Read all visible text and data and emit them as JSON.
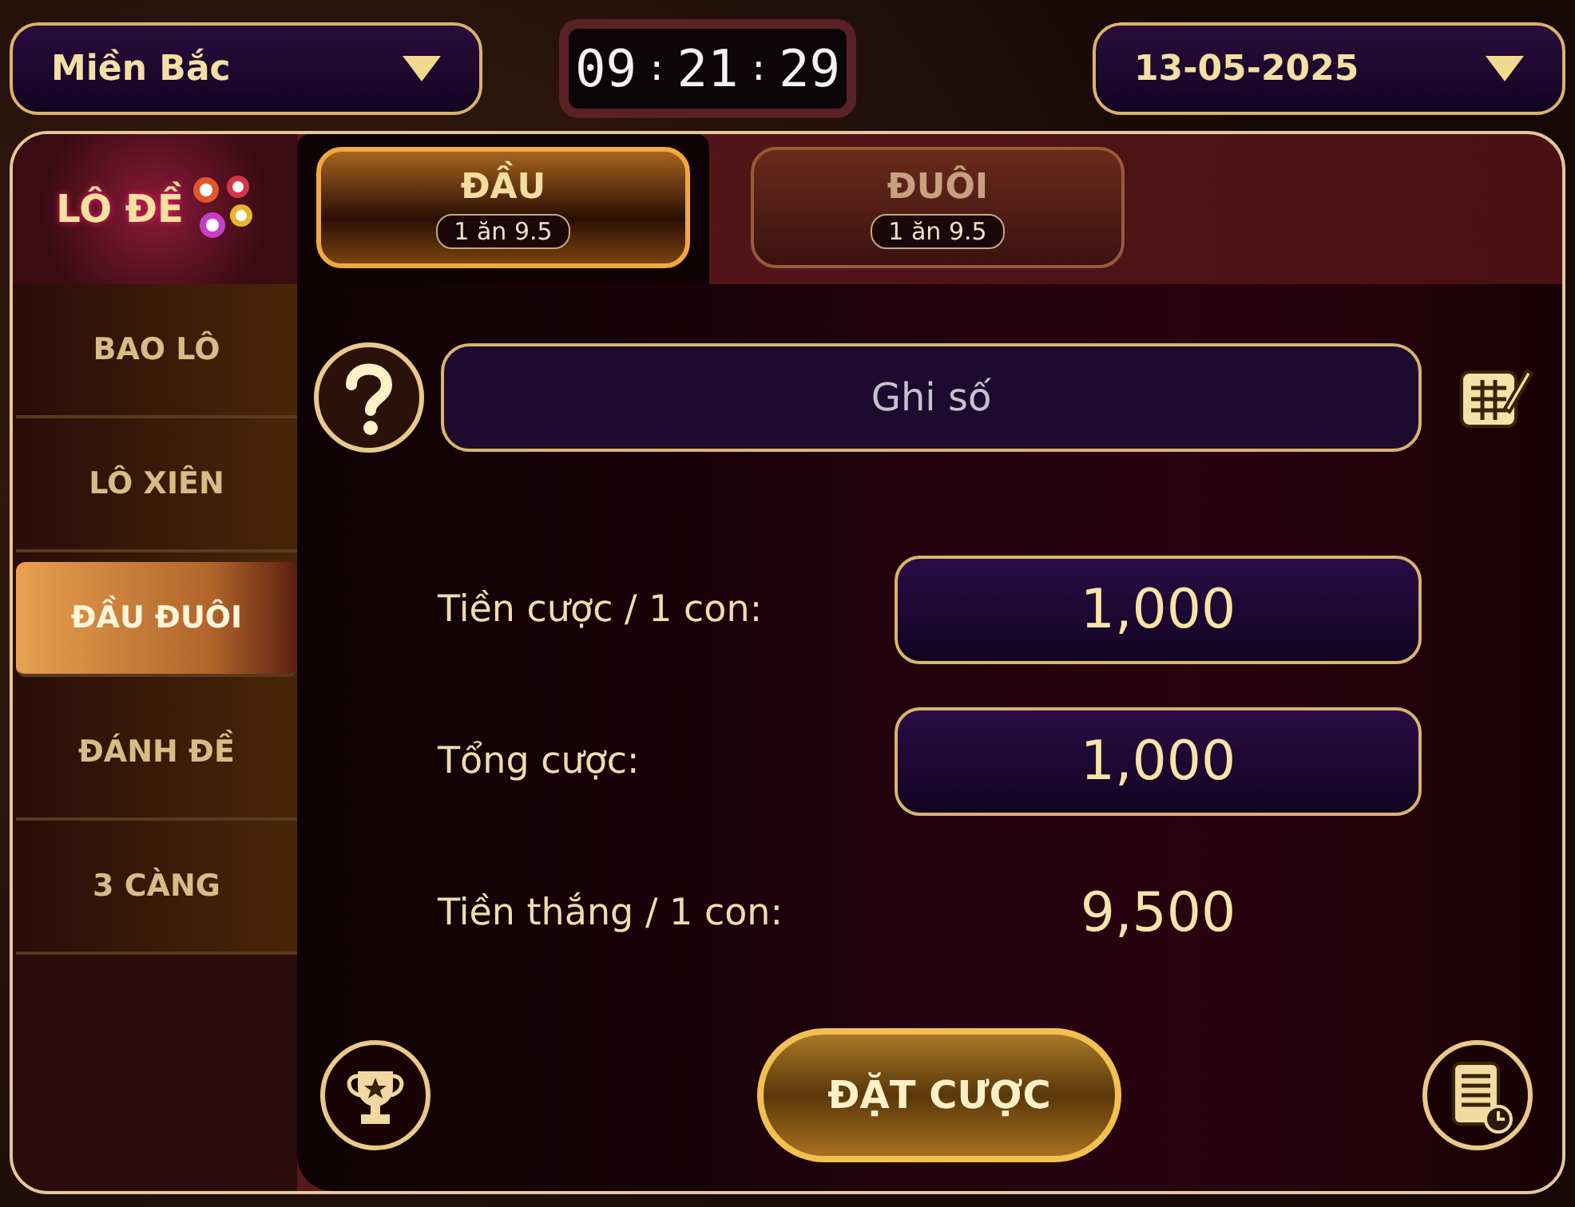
{
  "region_select": {
    "value": "Miền Bắc"
  },
  "clock": {
    "hours": "09",
    "minutes": "21",
    "seconds": "29",
    "separator": ":"
  },
  "date_select": {
    "value": "13-05-2025"
  },
  "logo": {
    "text": "LÔ ĐỀ"
  },
  "menu": [
    {
      "label": "BAO LÔ",
      "selected": false
    },
    {
      "label": "LÔ XIÊN",
      "selected": false
    },
    {
      "label": "ĐẦU ĐUÔI",
      "selected": true
    },
    {
      "label": "ĐÁNH ĐỀ",
      "selected": false
    },
    {
      "label": "3 CÀNG",
      "selected": false
    }
  ],
  "tabs": [
    {
      "label": "ĐẦU",
      "odds": "1 ăn 9.5",
      "selected": true
    },
    {
      "label": "ĐUÔI",
      "odds": "1 ăn 9.5",
      "selected": false
    }
  ],
  "number_input": {
    "placeholder": "Ghi số"
  },
  "fields": [
    {
      "kind": "box",
      "label": "Tiền cược / 1 con:",
      "value": "1,000"
    },
    {
      "kind": "box",
      "label": "Tổng cược:",
      "value": "1,000"
    },
    {
      "kind": "plain",
      "label": "Tiền thắng / 1 con:",
      "value": "9,500"
    }
  ],
  "bet_button": {
    "label": "ĐẶT CƯỢC"
  }
}
